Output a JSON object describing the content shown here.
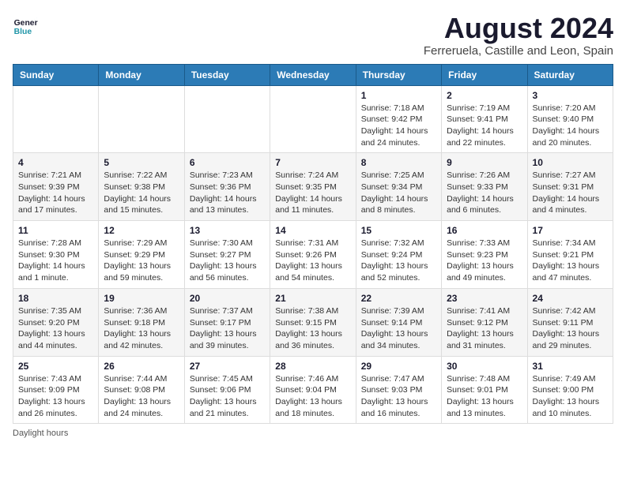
{
  "logo": {
    "line1": "General",
    "line2": "Blue"
  },
  "title": "August 2024",
  "subtitle": "Ferreruela, Castille and Leon, Spain",
  "calendar": {
    "headers": [
      "Sunday",
      "Monday",
      "Tuesday",
      "Wednesday",
      "Thursday",
      "Friday",
      "Saturday"
    ],
    "weeks": [
      [
        {
          "day": "",
          "info": ""
        },
        {
          "day": "",
          "info": ""
        },
        {
          "day": "",
          "info": ""
        },
        {
          "day": "",
          "info": ""
        },
        {
          "day": "1",
          "info": "Sunrise: 7:18 AM\nSunset: 9:42 PM\nDaylight: 14 hours and 24 minutes."
        },
        {
          "day": "2",
          "info": "Sunrise: 7:19 AM\nSunset: 9:41 PM\nDaylight: 14 hours and 22 minutes."
        },
        {
          "day": "3",
          "info": "Sunrise: 7:20 AM\nSunset: 9:40 PM\nDaylight: 14 hours and 20 minutes."
        }
      ],
      [
        {
          "day": "4",
          "info": "Sunrise: 7:21 AM\nSunset: 9:39 PM\nDaylight: 14 hours and 17 minutes."
        },
        {
          "day": "5",
          "info": "Sunrise: 7:22 AM\nSunset: 9:38 PM\nDaylight: 14 hours and 15 minutes."
        },
        {
          "day": "6",
          "info": "Sunrise: 7:23 AM\nSunset: 9:36 PM\nDaylight: 14 hours and 13 minutes."
        },
        {
          "day": "7",
          "info": "Sunrise: 7:24 AM\nSunset: 9:35 PM\nDaylight: 14 hours and 11 minutes."
        },
        {
          "day": "8",
          "info": "Sunrise: 7:25 AM\nSunset: 9:34 PM\nDaylight: 14 hours and 8 minutes."
        },
        {
          "day": "9",
          "info": "Sunrise: 7:26 AM\nSunset: 9:33 PM\nDaylight: 14 hours and 6 minutes."
        },
        {
          "day": "10",
          "info": "Sunrise: 7:27 AM\nSunset: 9:31 PM\nDaylight: 14 hours and 4 minutes."
        }
      ],
      [
        {
          "day": "11",
          "info": "Sunrise: 7:28 AM\nSunset: 9:30 PM\nDaylight: 14 hours and 1 minute."
        },
        {
          "day": "12",
          "info": "Sunrise: 7:29 AM\nSunset: 9:29 PM\nDaylight: 13 hours and 59 minutes."
        },
        {
          "day": "13",
          "info": "Sunrise: 7:30 AM\nSunset: 9:27 PM\nDaylight: 13 hours and 56 minutes."
        },
        {
          "day": "14",
          "info": "Sunrise: 7:31 AM\nSunset: 9:26 PM\nDaylight: 13 hours and 54 minutes."
        },
        {
          "day": "15",
          "info": "Sunrise: 7:32 AM\nSunset: 9:24 PM\nDaylight: 13 hours and 52 minutes."
        },
        {
          "day": "16",
          "info": "Sunrise: 7:33 AM\nSunset: 9:23 PM\nDaylight: 13 hours and 49 minutes."
        },
        {
          "day": "17",
          "info": "Sunrise: 7:34 AM\nSunset: 9:21 PM\nDaylight: 13 hours and 47 minutes."
        }
      ],
      [
        {
          "day": "18",
          "info": "Sunrise: 7:35 AM\nSunset: 9:20 PM\nDaylight: 13 hours and 44 minutes."
        },
        {
          "day": "19",
          "info": "Sunrise: 7:36 AM\nSunset: 9:18 PM\nDaylight: 13 hours and 42 minutes."
        },
        {
          "day": "20",
          "info": "Sunrise: 7:37 AM\nSunset: 9:17 PM\nDaylight: 13 hours and 39 minutes."
        },
        {
          "day": "21",
          "info": "Sunrise: 7:38 AM\nSunset: 9:15 PM\nDaylight: 13 hours and 36 minutes."
        },
        {
          "day": "22",
          "info": "Sunrise: 7:39 AM\nSunset: 9:14 PM\nDaylight: 13 hours and 34 minutes."
        },
        {
          "day": "23",
          "info": "Sunrise: 7:41 AM\nSunset: 9:12 PM\nDaylight: 13 hours and 31 minutes."
        },
        {
          "day": "24",
          "info": "Sunrise: 7:42 AM\nSunset: 9:11 PM\nDaylight: 13 hours and 29 minutes."
        }
      ],
      [
        {
          "day": "25",
          "info": "Sunrise: 7:43 AM\nSunset: 9:09 PM\nDaylight: 13 hours and 26 minutes."
        },
        {
          "day": "26",
          "info": "Sunrise: 7:44 AM\nSunset: 9:08 PM\nDaylight: 13 hours and 24 minutes."
        },
        {
          "day": "27",
          "info": "Sunrise: 7:45 AM\nSunset: 9:06 PM\nDaylight: 13 hours and 21 minutes."
        },
        {
          "day": "28",
          "info": "Sunrise: 7:46 AM\nSunset: 9:04 PM\nDaylight: 13 hours and 18 minutes."
        },
        {
          "day": "29",
          "info": "Sunrise: 7:47 AM\nSunset: 9:03 PM\nDaylight: 13 hours and 16 minutes."
        },
        {
          "day": "30",
          "info": "Sunrise: 7:48 AM\nSunset: 9:01 PM\nDaylight: 13 hours and 13 minutes."
        },
        {
          "day": "31",
          "info": "Sunrise: 7:49 AM\nSunset: 9:00 PM\nDaylight: 13 hours and 10 minutes."
        }
      ]
    ]
  },
  "footer": "Daylight hours"
}
